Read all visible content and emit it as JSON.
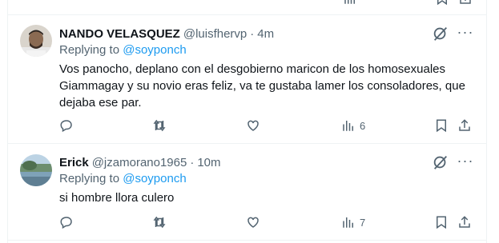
{
  "tweets": [
    {
      "display_name": "NANDO VELASQUEZ",
      "handle": "@luisfhervp",
      "separator": "·",
      "time": "4m",
      "replying_prefix": "Replying to",
      "replying_to": "@soyponch",
      "text": "Vos panocho, deplano con el desgobierno maricon de los homosexuales Giammagay y su novio eras feliz, va te gustaba lamer los consoladores, que dejaba ese par.",
      "views": "6",
      "icons": [
        "grok-icon",
        "more-icon",
        "reply-icon",
        "retweet-icon",
        "like-icon",
        "views-icon",
        "bookmark-icon",
        "share-icon"
      ]
    },
    {
      "display_name": "Erick",
      "handle": "@jzamorano1965",
      "separator": "·",
      "time": "10m",
      "replying_prefix": "Replying to",
      "replying_to": "@soyponch",
      "text": "si hombre llora culero",
      "views": "7",
      "icons": [
        "grok-icon",
        "more-icon",
        "reply-icon",
        "retweet-icon",
        "like-icon",
        "views-icon",
        "bookmark-icon",
        "share-icon"
      ]
    }
  ],
  "more_label": "···",
  "colors": {
    "text": "#0f1419",
    "secondary": "#536471",
    "link": "#1d9bf0",
    "divider": "#eff3f4"
  }
}
